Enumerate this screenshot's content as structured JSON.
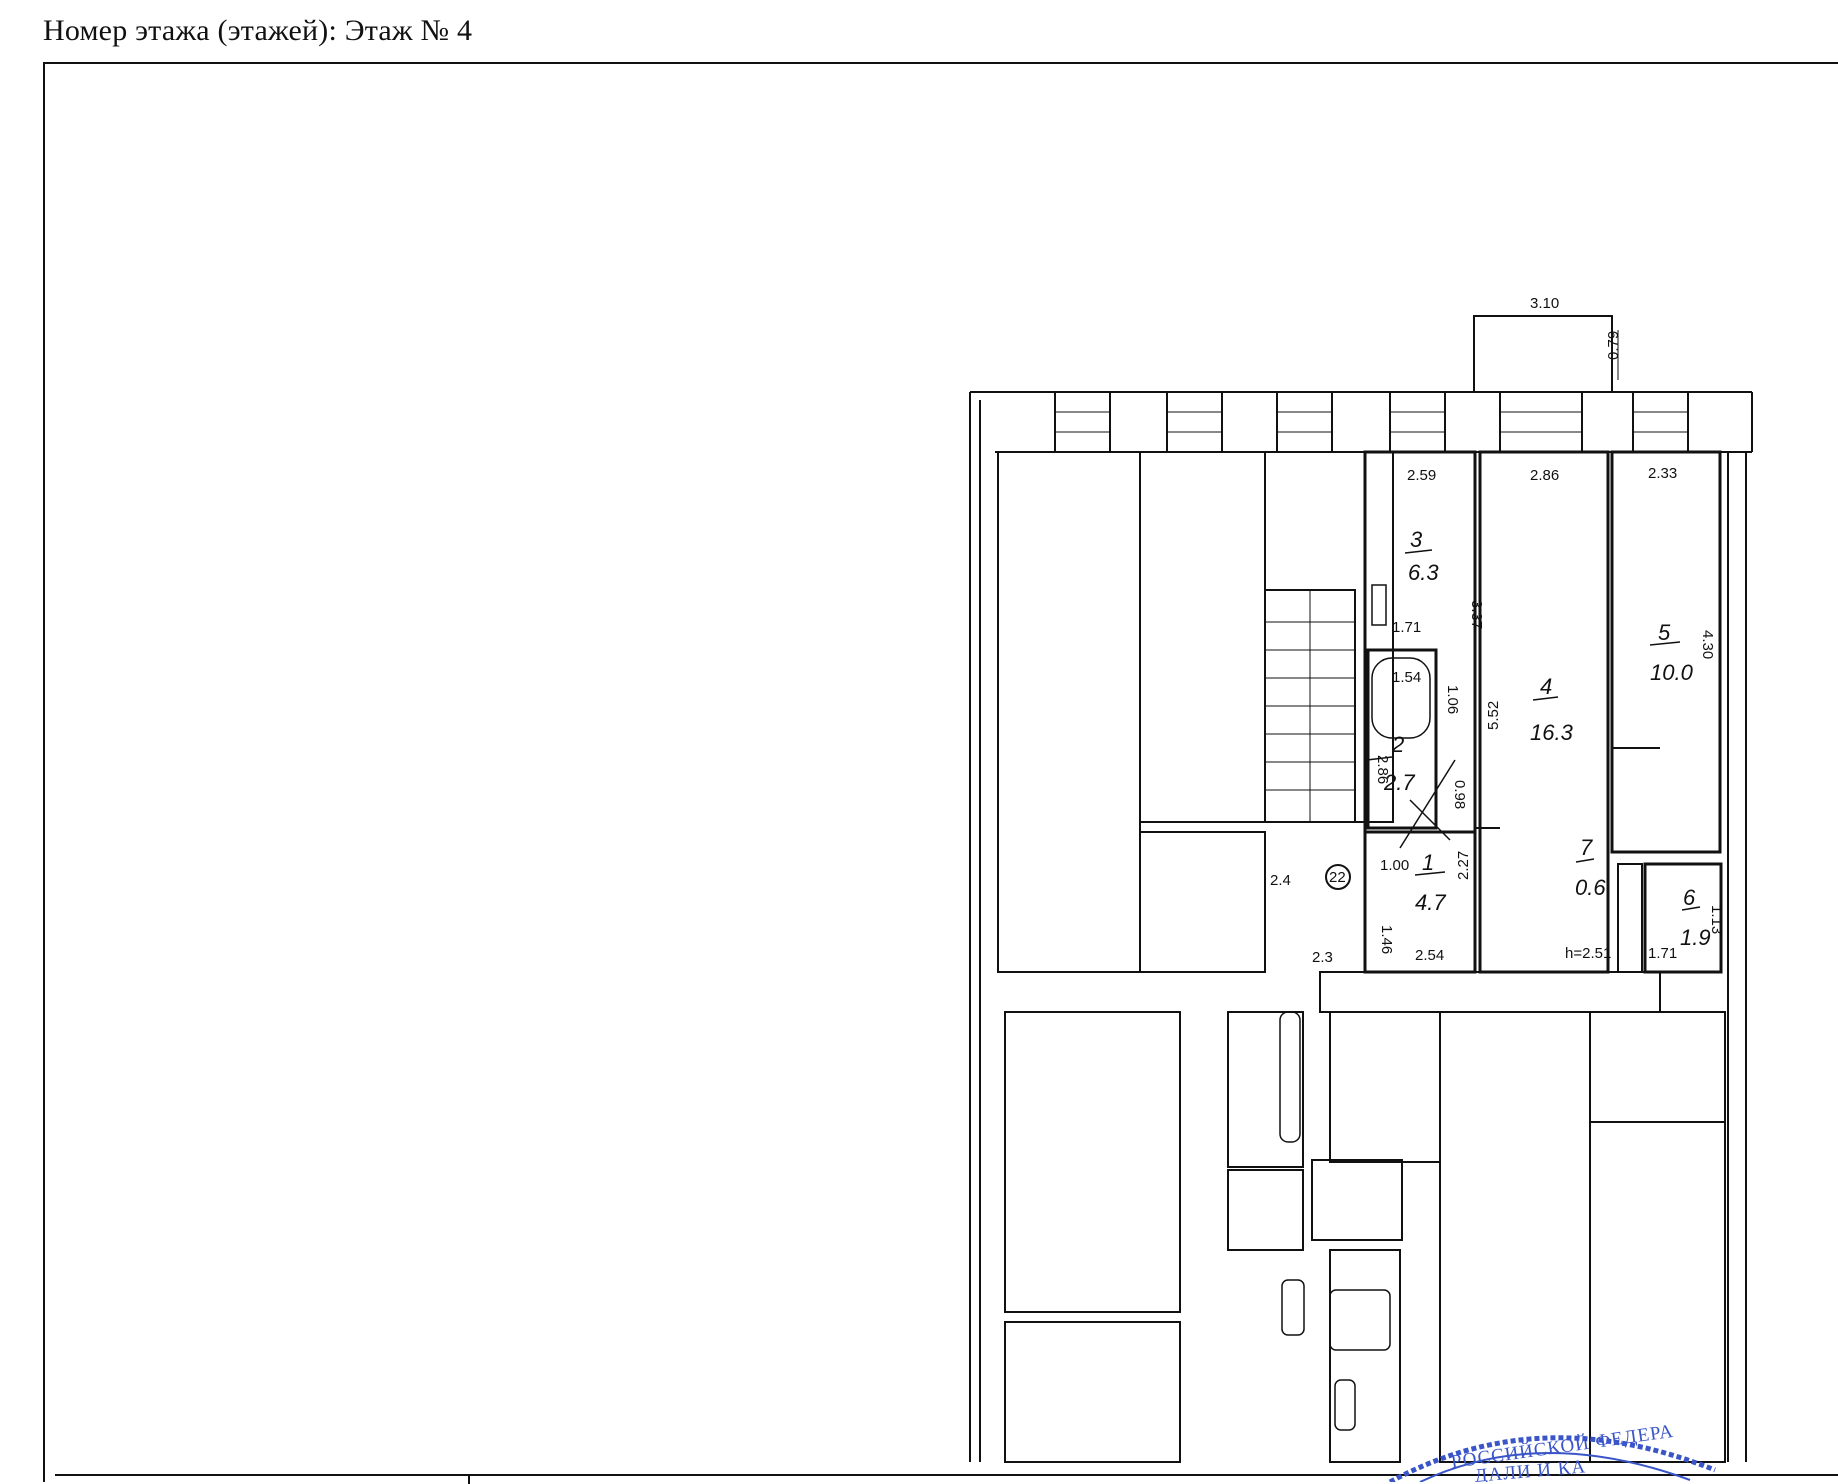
{
  "header": {
    "label": "Номер этажа (этажей):",
    "value": "Этаж № 4"
  },
  "plan": {
    "balcony_width": "3.10",
    "balcony_depth": "0.79",
    "rooms": [
      {
        "id": "room-1",
        "number": "1",
        "area": "4.7"
      },
      {
        "id": "room-2",
        "number": "2",
        "area": "2.7"
      },
      {
        "id": "room-3",
        "number": "3",
        "area": "6.3"
      },
      {
        "id": "room-4",
        "number": "4",
        "area": "16.3"
      },
      {
        "id": "room-5",
        "number": "5",
        "area": "10.0"
      },
      {
        "id": "room-6",
        "number": "6",
        "area": "1.9"
      },
      {
        "id": "room-7",
        "number": "7",
        "area": "0.6"
      }
    ],
    "apartment_number": "22",
    "dims": {
      "room3_w": "2.59",
      "room4_w": "2.86",
      "room5_w": "2.33",
      "room3_h": "3.37",
      "room5_h": "4.30",
      "room4_h": "5.52",
      "wc_w": "1.71",
      "bath_w": "1.54",
      "bath_h": "1.06",
      "room2_h": "2.86",
      "room2_w": "0.98",
      "hall_w": "1.00",
      "hall_h": "2.27",
      "hall_bottom": "2.54",
      "stair_h": "2.4",
      "stair_w": "2.3",
      "hall_side": "1.46",
      "ceiling": "h=2.51",
      "room6_w": "1.71",
      "room6_h": "1.13"
    }
  },
  "stamp": {
    "line1": "РОССИЙСКОЙ ФЕДЕРА",
    "line2": "ДАЛИ И КА"
  }
}
